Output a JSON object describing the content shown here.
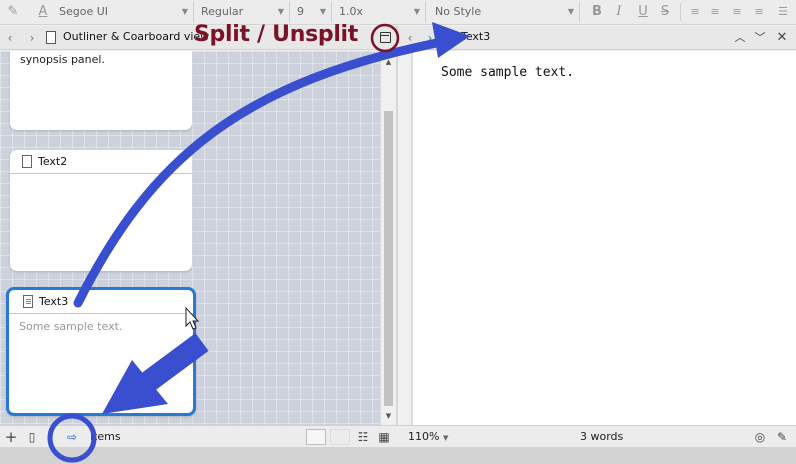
{
  "format_toolbar": {
    "font_family": "Segoe UI",
    "font_style": "Regular",
    "font_size": "9",
    "line_spacing": "1.0x",
    "paragraph_style": "No Style",
    "bold_label": "B",
    "italic_label": "I",
    "underline_label": "U",
    "strike_label": "S"
  },
  "left_pane": {
    "view_title": "Outliner & Coarboard view",
    "cards": [
      {
        "title": "",
        "body": "synopsis panel."
      },
      {
        "title": "Text2",
        "body": ""
      },
      {
        "title": "Text3",
        "body": "Some sample text."
      }
    ],
    "footer": {
      "items_label": "items"
    }
  },
  "right_pane": {
    "doc_title": "Text3",
    "content": "Some sample text.",
    "footer": {
      "zoom": "110%",
      "word_count": "3 words"
    }
  },
  "annotation": {
    "split_label": "Split / Unsplit",
    "accent_color": "#3a4fcf",
    "label_color": "#7a1228"
  }
}
